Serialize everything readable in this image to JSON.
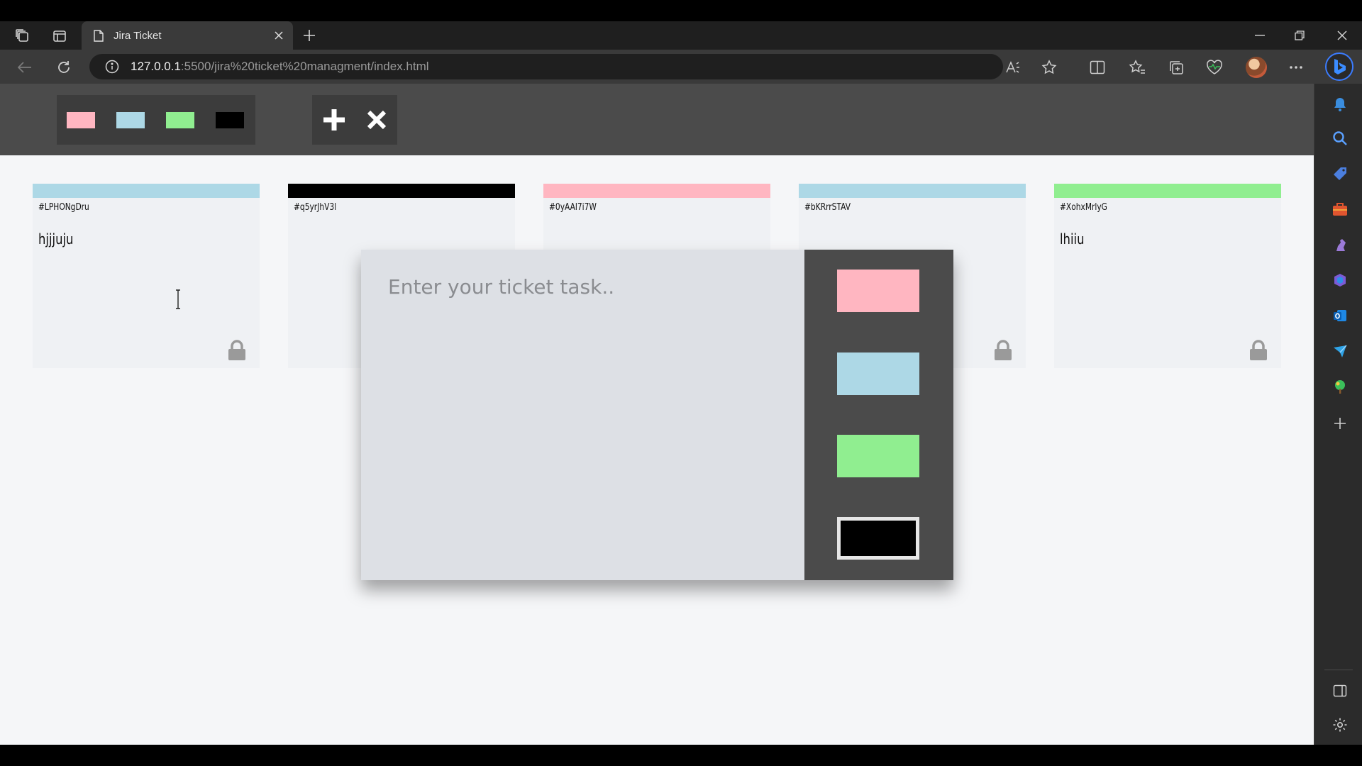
{
  "browser": {
    "tab_title": "Jira Ticket",
    "url_host": "127.0.0.1",
    "url_path": ":5500/jira%20ticket%20managment/index.html"
  },
  "toolbar": {
    "colors": [
      "#ffb6c1",
      "#add8e6",
      "#90ee90",
      "#000000"
    ],
    "add_icon": "plus-icon",
    "remove_icon": "close-icon"
  },
  "tickets": [
    {
      "id": "#LPHONgDru",
      "task": "hjjjuju",
      "color": "#add8e6"
    },
    {
      "id": "#q5yrJhV3l",
      "task": "",
      "color": "#000000"
    },
    {
      "id": "#0yAAl7i7W",
      "task": "",
      "color": "#ffb6c1"
    },
    {
      "id": "#bKRrrSTAV",
      "task": "",
      "color": "#add8e6"
    },
    {
      "id": "#XohxMrlyG",
      "task": "lhiiu",
      "color": "#90ee90"
    }
  ],
  "modal": {
    "placeholder": "Enter your ticket task..",
    "colors": [
      "#ffb6c1",
      "#add8e6",
      "#90ee90",
      "#000000"
    ],
    "selected_color": "#000000"
  }
}
